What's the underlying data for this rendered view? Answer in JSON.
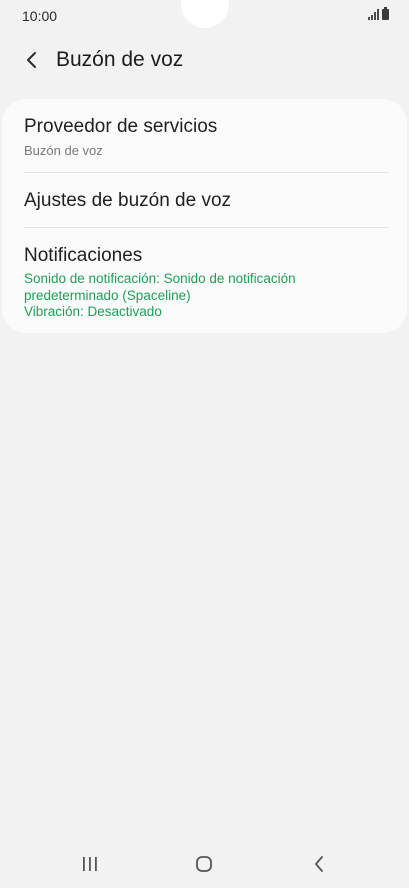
{
  "status_bar": {
    "time": "10:00",
    "icons": [
      "signal-icon",
      "battery-icon"
    ]
  },
  "header": {
    "back_icon": "chevron-left-icon",
    "title": "Buzón de voz"
  },
  "settings": {
    "items": [
      {
        "title": "Proveedor de servicios",
        "subtitle": "Buzón de voz"
      },
      {
        "title": "Ajustes de buzón de voz"
      },
      {
        "title": "Notificaciones",
        "details": [
          "Sonido de notificación: Sonido de notificación",
          "predeterminado (Spaceline)",
          "Vibración: Desactivado"
        ]
      }
    ]
  },
  "nav_bar": {
    "icons": [
      "recent-apps-icon",
      "home-icon",
      "back-icon"
    ]
  },
  "colors": {
    "background": "#f2f2f2",
    "card": "#fbfbfb",
    "accent_green": "#1e9e57",
    "secondary_text": "#7a7a7a"
  }
}
